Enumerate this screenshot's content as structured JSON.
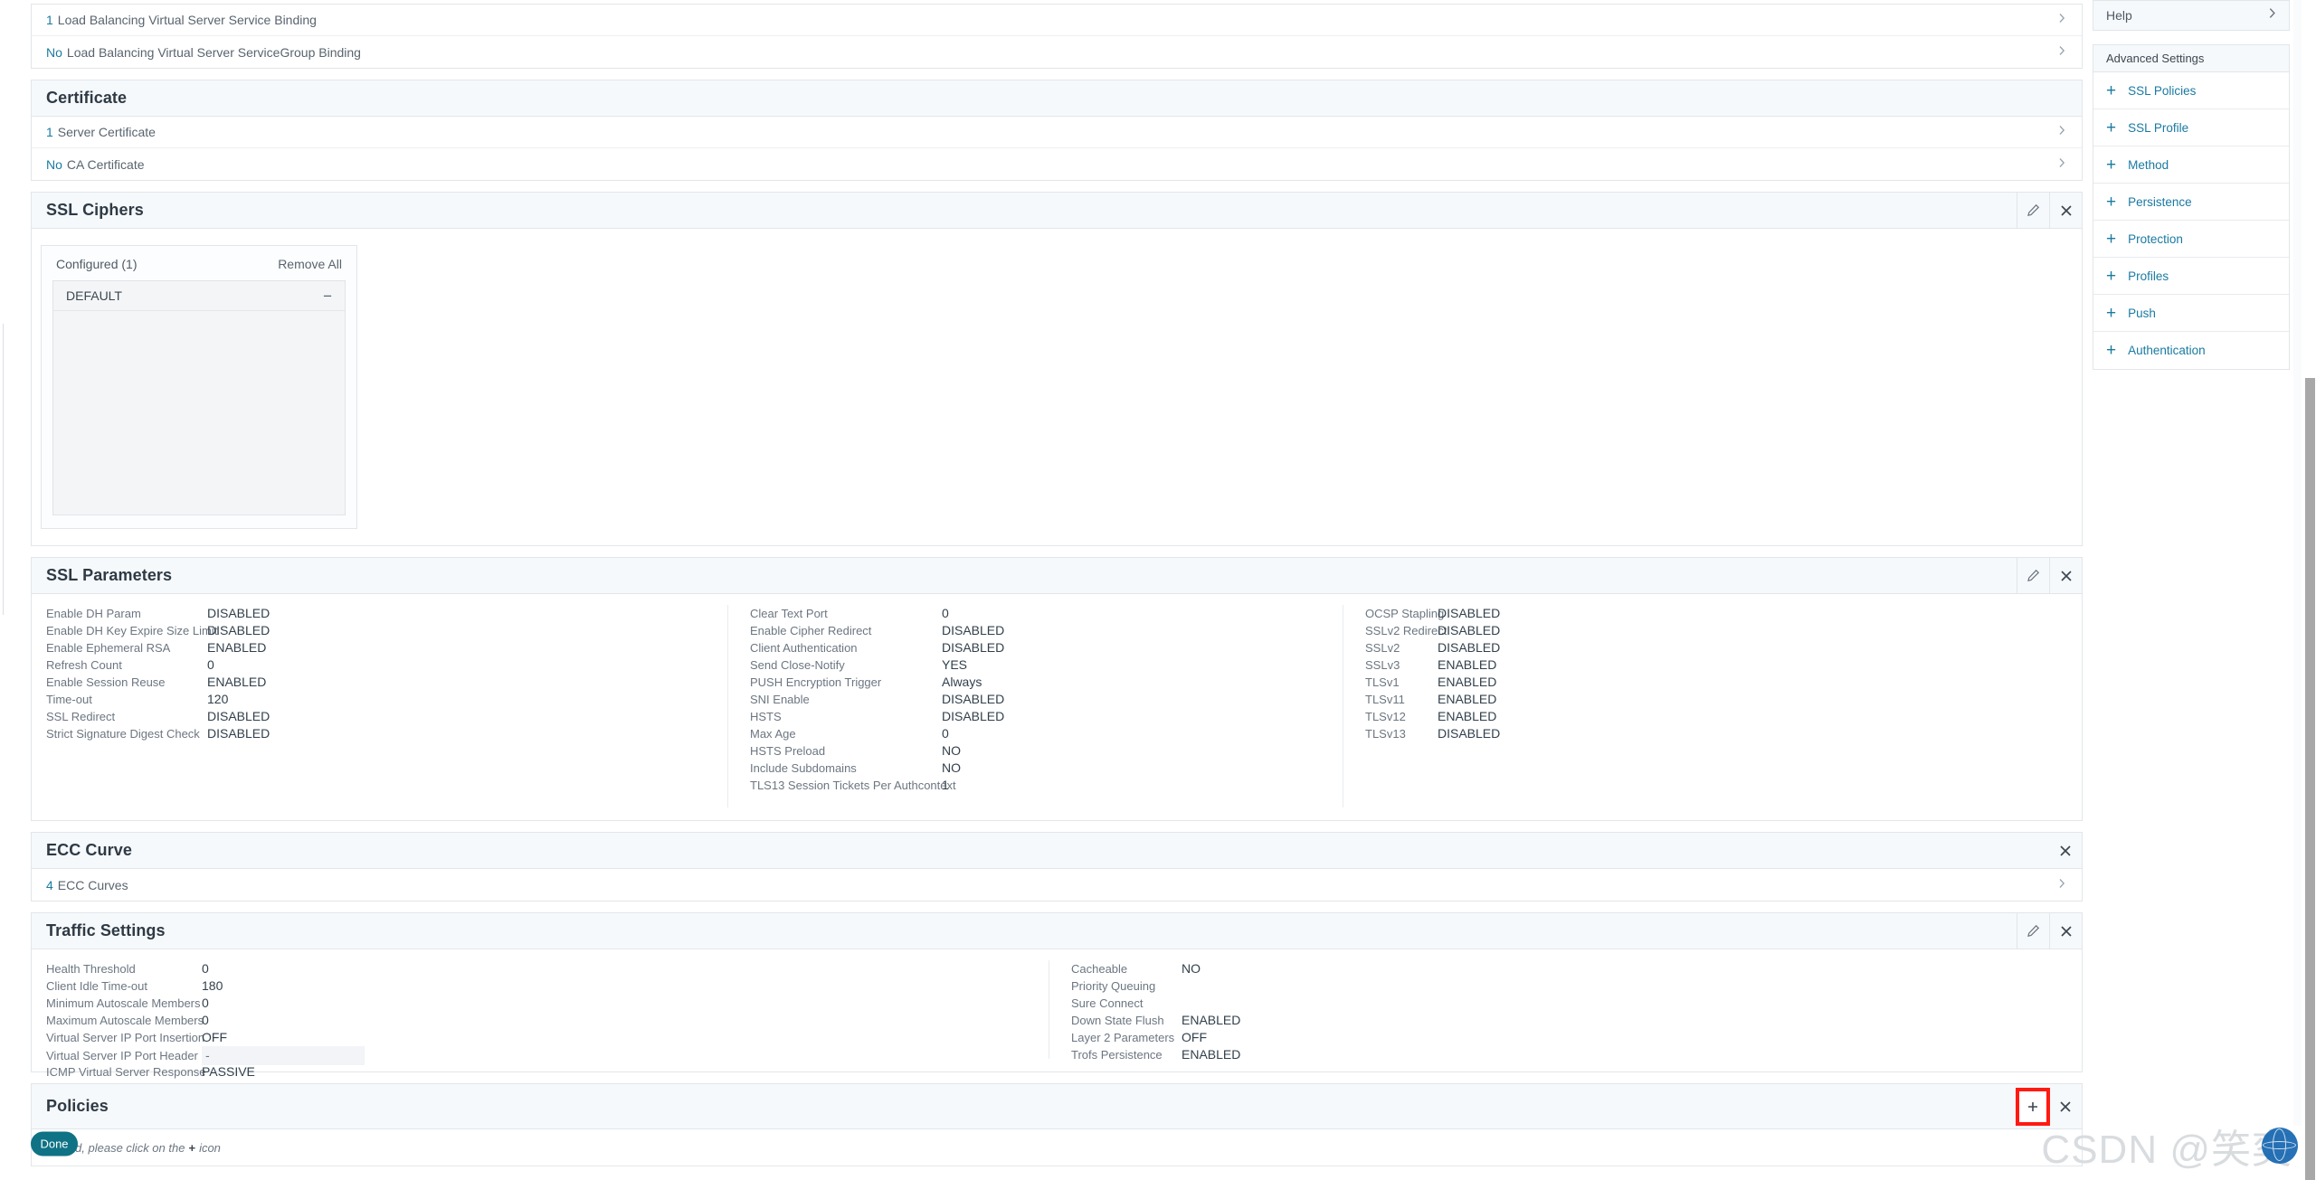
{
  "bindings": {
    "rows": [
      {
        "count": "1",
        "label": "Load Balancing Virtual Server Service Binding"
      },
      {
        "count": "No",
        "label": "Load Balancing Virtual Server ServiceGroup Binding"
      }
    ]
  },
  "certificate": {
    "title": "Certificate",
    "rows": [
      {
        "count": "1",
        "label": "Server Certificate"
      },
      {
        "count": "No",
        "label": "CA Certificate"
      }
    ]
  },
  "ssl_ciphers": {
    "title": "SSL Ciphers",
    "configured_label": "Configured (1)",
    "remove_all_label": "Remove All",
    "items": [
      "DEFAULT"
    ]
  },
  "ssl_parameters": {
    "title": "SSL Parameters",
    "col1": [
      {
        "k": "Enable DH Param",
        "v": "DISABLED"
      },
      {
        "k": "Enable DH Key Expire Size Limit",
        "v": "DISABLED"
      },
      {
        "k": "Enable Ephemeral RSA",
        "v": "ENABLED"
      },
      {
        "k": "Refresh Count",
        "v": "0"
      },
      {
        "k": "Enable Session Reuse",
        "v": "ENABLED"
      },
      {
        "k": "Time-out",
        "v": "120"
      },
      {
        "k": "SSL Redirect",
        "v": "DISABLED"
      },
      {
        "k": "Strict Signature Digest Check",
        "v": "DISABLED"
      }
    ],
    "col2": [
      {
        "k": "Clear Text Port",
        "v": "0"
      },
      {
        "k": "Enable Cipher Redirect",
        "v": "DISABLED"
      },
      {
        "k": "Client Authentication",
        "v": "DISABLED"
      },
      {
        "k": "Send Close-Notify",
        "v": "YES"
      },
      {
        "k": "PUSH Encryption Trigger",
        "v": "Always"
      },
      {
        "k": "SNI Enable",
        "v": "DISABLED"
      },
      {
        "k": "HSTS",
        "v": "DISABLED"
      },
      {
        "k": "Max Age",
        "v": "0"
      },
      {
        "k": "HSTS Preload",
        "v": "NO"
      },
      {
        "k": "Include Subdomains",
        "v": "NO"
      },
      {
        "k": "TLS13 Session Tickets Per Authcontext",
        "v": "1"
      }
    ],
    "col3": [
      {
        "k": "OCSP Stapling",
        "v": "DISABLED"
      },
      {
        "k": "SSLv2 Redirect",
        "v": "DISABLED"
      },
      {
        "k": "SSLv2",
        "v": "DISABLED"
      },
      {
        "k": "SSLv3",
        "v": "ENABLED"
      },
      {
        "k": "TLSv1",
        "v": "ENABLED"
      },
      {
        "k": "TLSv11",
        "v": "ENABLED"
      },
      {
        "k": "TLSv12",
        "v": "ENABLED"
      },
      {
        "k": "TLSv13",
        "v": "DISABLED"
      }
    ]
  },
  "ecc_curve": {
    "title": "ECC Curve",
    "rows": [
      {
        "count": "4",
        "label": "ECC Curves"
      }
    ]
  },
  "traffic_settings": {
    "title": "Traffic Settings",
    "col1": [
      {
        "k": "Health Threshold",
        "v": "0"
      },
      {
        "k": "Client Idle Time-out",
        "v": "180"
      },
      {
        "k": "Minimum Autoscale Members",
        "v": "0"
      },
      {
        "k": "Maximum Autoscale Members",
        "v": "0"
      },
      {
        "k": "Virtual Server IP Port Insertion",
        "v": "OFF"
      },
      {
        "k": "Virtual Server IP Port Header",
        "v": "-",
        "boxed": true
      },
      {
        "k": "ICMP Virtual Server Response",
        "v": "PASSIVE"
      }
    ],
    "col2": [
      {
        "k": "Cacheable",
        "v": "NO"
      },
      {
        "k": "Priority Queuing",
        "v": ""
      },
      {
        "k": "Sure Connect",
        "v": ""
      },
      {
        "k": "Down State Flush",
        "v": "ENABLED"
      },
      {
        "k": "Layer 2 Parameters",
        "v": "OFF"
      },
      {
        "k": "Trofs Persistence",
        "v": "ENABLED"
      }
    ]
  },
  "policies": {
    "title": "Policies",
    "empty_prefix": "To add, please click on the",
    "empty_plus": "+",
    "empty_suffix": "icon"
  },
  "footer": {
    "done_label": "Done"
  },
  "sidebar": {
    "help_label": "Help",
    "advanced_title": "Advanced Settings",
    "items": [
      {
        "label": "SSL Policies"
      },
      {
        "label": "SSL Profile"
      },
      {
        "label": "Method"
      },
      {
        "label": "Persistence"
      },
      {
        "label": "Protection"
      },
      {
        "label": "Profiles"
      },
      {
        "label": "Push"
      },
      {
        "label": "Authentication"
      }
    ]
  },
  "watermark": {
    "text": "CSDN @笑奕"
  },
  "colors": {
    "accent_link": "#1a7aa2",
    "done_button": "#0f7285",
    "header_bg": "#f6f9fb",
    "highlight": "#ff1a12"
  }
}
